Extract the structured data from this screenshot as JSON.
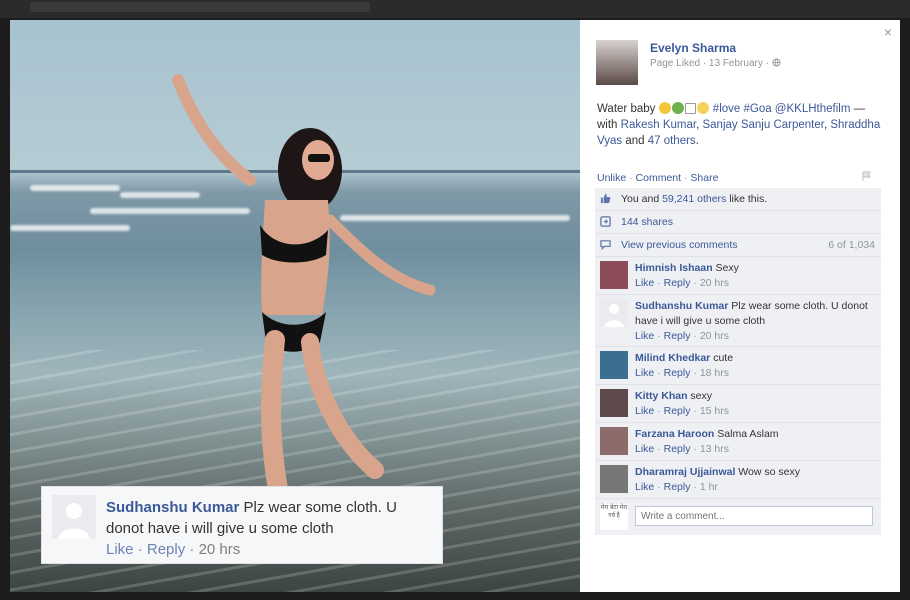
{
  "post": {
    "author": "Evelyn Sharma",
    "meta": "Page Liked · 13 February ·",
    "caption_text": "Water baby",
    "caption_hashtags": "#love #Goa @KKLHthefilm",
    "caption_with": " — with ",
    "tagged_1": "Rakesh Kumar",
    "tagged_2": "Sanjay Sanju Carpenter",
    "tagged_3": "Shraddha Vyas",
    "caption_and": " and ",
    "tagged_others": "47 others",
    "caption_end": "."
  },
  "actions": {
    "unlike": "Unlike",
    "comment": "Comment",
    "share": "Share"
  },
  "likes": {
    "you_and": "You and",
    "count": "59,241 others",
    "like_this": "like this."
  },
  "shares": {
    "label": "144 shares"
  },
  "previous": {
    "label": "View previous comments",
    "count": "6 of 1,034"
  },
  "comments": [
    {
      "author": "Himnish Ishaan",
      "text": "Sexy",
      "like": "Like",
      "reply": "Reply",
      "time": "20 hrs",
      "avatar_color": "#8d4c5a"
    },
    {
      "author": "Sudhanshu Kumar",
      "text": "Plz wear some cloth. U donot have i will give u some cloth",
      "like": "Like",
      "reply": "Reply",
      "time": "20 hrs",
      "avatar_color": "#e9ebee"
    },
    {
      "author": "Milind Khedkar",
      "text": "cute",
      "like": "Like",
      "reply": "Reply",
      "time": "18 hrs",
      "avatar_color": "#3c6e91"
    },
    {
      "author": "Kitty Khan",
      "text": "sexy",
      "like": "Like",
      "reply": "Reply",
      "time": "15 hrs",
      "avatar_color": "#5e4a4a"
    },
    {
      "author": "Farzana Haroon",
      "text": "Salma Aslam",
      "like": "Like",
      "reply": "Reply",
      "time": "13 hrs",
      "avatar_color": "#8c6c6a"
    },
    {
      "author": "Dharamraj Ujjainwal",
      "text": "Wow so sexy",
      "like": "Like",
      "reply": "Reply",
      "time": "1 hr",
      "avatar_color": "#777777"
    }
  ],
  "write_comment": {
    "placeholder": "Write a comment...",
    "avatar_text": "मेरा बेटा मेरा गर्व है"
  },
  "overlay": {
    "author": "Sudhanshu Kumar",
    "text": "Plz wear some cloth. U donot have i will give u some cloth",
    "like": "Like",
    "reply": "Reply",
    "time": "20 hrs"
  },
  "close_glyph": "×",
  "colors": {
    "link": "#3b5998",
    "panel_bg": "#ffffff",
    "ufi_bg": "#eef0f4"
  }
}
